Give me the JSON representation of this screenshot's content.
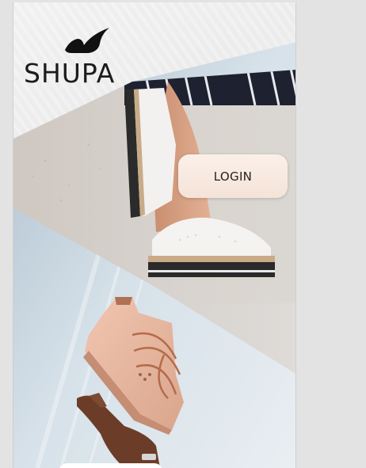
{
  "app": {
    "brand_name": "SHUPA",
    "logo_icon": "shoe-swoosh-icon"
  },
  "login": {
    "label": "LOGIN"
  },
  "hero": {
    "top_image_icon": "platform-oxford-shoe-photo",
    "bottom_image_icon": "pink-sneaker-on-hand-photo"
  },
  "colors": {
    "background": "#e3e3e3",
    "login_bg": "#f7e8de",
    "brand_text": "#1c1c1c",
    "sneaker": "#e8b59d"
  }
}
